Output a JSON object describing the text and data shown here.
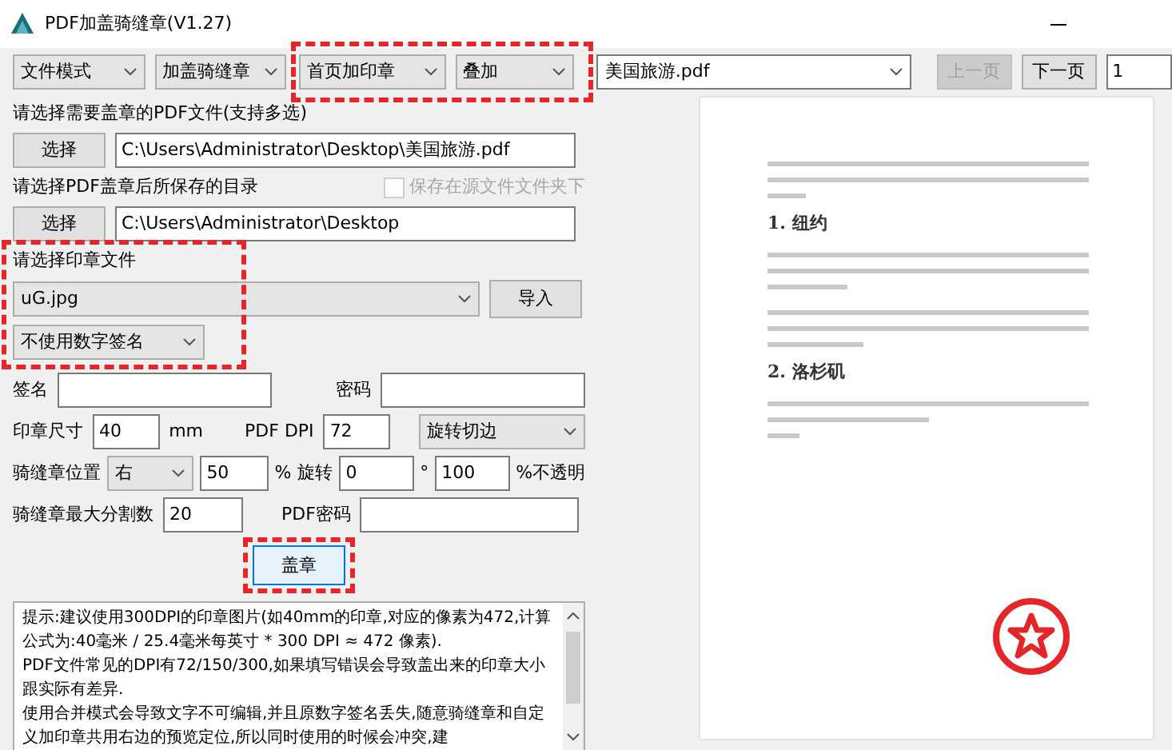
{
  "window": {
    "title": "PDF加盖骑缝章(V1.27)"
  },
  "toolbar": {
    "mode_dropdowns": [
      {
        "value": "文件模式"
      },
      {
        "value": "加盖骑缝章"
      },
      {
        "value": "首页加印章"
      },
      {
        "value": "叠加"
      }
    ],
    "file_dropdown": {
      "value": "美国旅游.pdf"
    },
    "page_buttons": [
      {
        "label": "上一页",
        "disabled": true
      },
      {
        "label": "下一页",
        "disabled": false
      }
    ],
    "page_field": {
      "value": "1"
    }
  },
  "form_rows": [
    [
      {
        "kind": "label",
        "text": "请选择需要盖章的PDF文件(支持多选)"
      }
    ],
    [
      {
        "kind": "button",
        "text": "选择"
      },
      {
        "kind": "input",
        "value": "C:\\Users\\Administrator\\Desktop\\美国旅游.pdf"
      }
    ],
    [
      {
        "kind": "label",
        "text": "请选择PDF盖章后所保存的目录"
      },
      {
        "kind": "checkbox",
        "text": "保存在源文件文件夹下",
        "checked": false,
        "disabled": true
      }
    ],
    [
      {
        "kind": "button",
        "text": "选择"
      },
      {
        "kind": "input",
        "value": "C:\\Users\\Administrator\\Desktop"
      }
    ],
    [
      {
        "kind": "label",
        "text": "请选择印章文件"
      }
    ],
    [
      {
        "kind": "select",
        "value": "uG.jpg"
      },
      {
        "kind": "button",
        "text": "导入"
      }
    ],
    [
      {
        "kind": "select",
        "value": "不使用数字签名"
      }
    ],
    [
      {
        "kind": "label",
        "text": "签名"
      },
      {
        "kind": "input"
      },
      {
        "kind": "label",
        "text": "密码"
      },
      {
        "kind": "input"
      }
    ],
    [
      {
        "kind": "label",
        "text": "印章尺寸"
      },
      {
        "kind": "input",
        "value": "40"
      },
      {
        "kind": "label",
        "text": "mm"
      },
      {
        "kind": "label",
        "text": "PDF DPI"
      },
      {
        "kind": "input",
        "value": "72"
      },
      {
        "kind": "select",
        "value": "旋转切边"
      }
    ],
    [
      {
        "kind": "label",
        "text": "骑缝章位置"
      },
      {
        "kind": "select",
        "value": "右"
      },
      {
        "kind": "input",
        "value": "50"
      },
      {
        "kind": "label",
        "text": "%"
      },
      {
        "kind": "label",
        "text": "旋转"
      },
      {
        "kind": "input",
        "value": "0"
      },
      {
        "kind": "label",
        "text": "°"
      },
      {
        "kind": "input",
        "value": "100"
      },
      {
        "kind": "label",
        "text": "%不透明"
      }
    ],
    [
      {
        "kind": "label",
        "text": "骑缝章最大分割数"
      },
      {
        "kind": "input",
        "value": "20"
      },
      {
        "kind": "label",
        "text": "PDF密码"
      },
      {
        "kind": "input"
      }
    ],
    [
      {
        "kind": "primary",
        "text": "盖章"
      }
    ]
  ],
  "hint_lines": [
    "提示:建议使用300DPI的印章图片(如40mm的印章,对应的像素为472,计算公式为:40毫米 / 25.4毫米每英寸 * 300 DPI ≈ 472 像素).",
    "PDF文件常见的DPI有72/150/300,如果填写错误会导致盖出来的印章大小跟实际有差异.",
    "使用合并模式会导致文字不可编辑,并且原数字签名丢失,随意骑缝章和自定义加印章共用右边的预览定位,所以同时使用的时候会冲突,建"
  ],
  "preview": {
    "headings": [
      "1. 纽约",
      "2. 洛杉矶"
    ]
  }
}
